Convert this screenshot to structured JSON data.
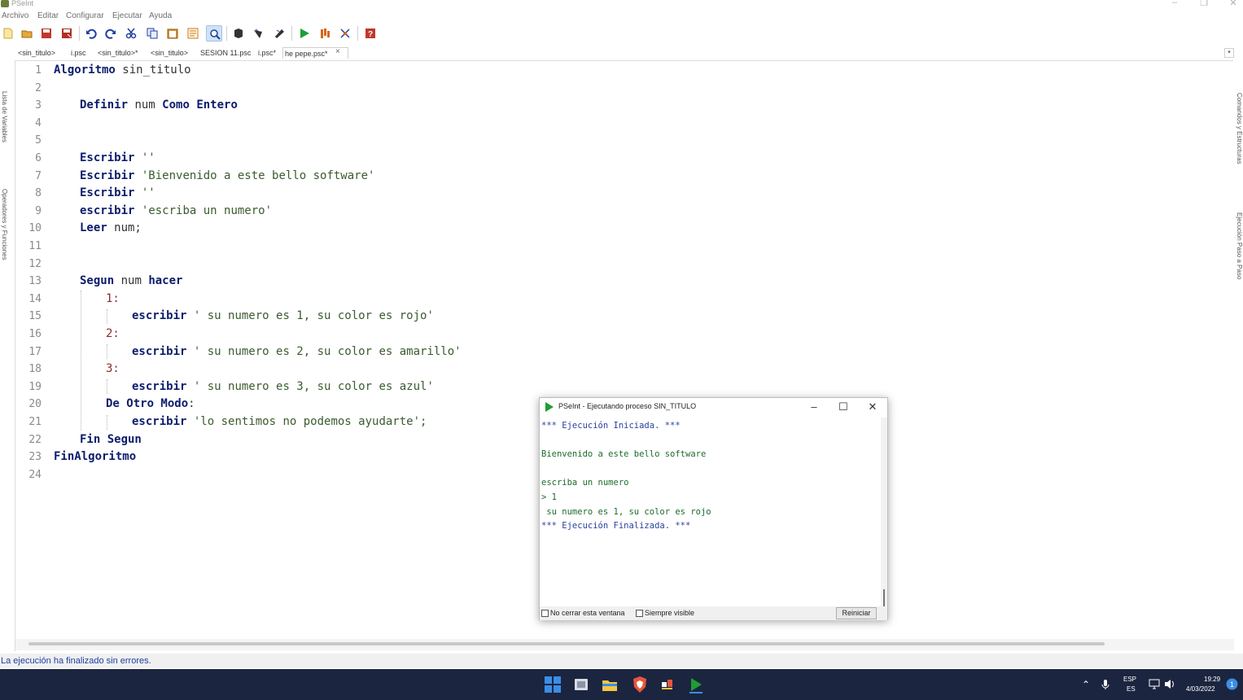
{
  "window": {
    "title": "PSeInt"
  },
  "menu": [
    "Archivo",
    "Editar",
    "Configurar",
    "Ejecutar",
    "Ayuda"
  ],
  "toolbar": [
    {
      "icon": "new-file-icon",
      "color": "#f2d35a"
    },
    {
      "icon": "open-folder-icon",
      "color": "#d9962b"
    },
    {
      "icon": "save-icon",
      "color": "#c0392b"
    },
    {
      "icon": "save-as-icon",
      "color": "#c0392b"
    },
    {
      "icon": "undo-icon",
      "color": "#1f3fa0"
    },
    {
      "icon": "redo-icon",
      "color": "#1f3fa0"
    },
    {
      "icon": "cut-icon",
      "color": "#1f3fa0"
    },
    {
      "icon": "copy-icon",
      "color": "#1f3fa0"
    },
    {
      "icon": "paste-icon",
      "color": "#c97a1a"
    },
    {
      "icon": "indent-icon",
      "color": "#c97a1a"
    },
    {
      "icon": "search-icon",
      "color": "#1f3fa0"
    },
    {
      "icon": "flowchart-icon",
      "color": "#222222"
    },
    {
      "icon": "debug-icon",
      "color": "#222222"
    },
    {
      "icon": "step-icon",
      "color": "#222222"
    },
    {
      "icon": "run-icon",
      "color": "#1e9e33"
    },
    {
      "icon": "step-by-step-icon",
      "color": "#d9661b"
    },
    {
      "icon": "draw-flow-icon",
      "color": "#1f3fa0"
    },
    {
      "icon": "help-icon",
      "color": "#c0392b"
    }
  ],
  "left_panel": {
    "vars": "Lista de Variables",
    "ops": "Operadores y Funciones"
  },
  "right_panel": {
    "commands": "Comandos y Estructuras",
    "exec": "Ejecución Paso a Paso"
  },
  "tabs": [
    {
      "label": "<sin_titulo>"
    },
    {
      "label": "i.psc"
    },
    {
      "label": "<sin_titulo>*"
    },
    {
      "label": "<sin_titulo>"
    },
    {
      "label": "SESION 11.psc"
    },
    {
      "label": "i.psc*"
    },
    {
      "label": "he pepe.psc*"
    }
  ],
  "tab_close": "×",
  "editor": {
    "lines": [
      {
        "n": "1"
      },
      {
        "n": "2"
      },
      {
        "n": "3"
      },
      {
        "n": "4"
      },
      {
        "n": "5"
      },
      {
        "n": "6"
      },
      {
        "n": "7"
      },
      {
        "n": "8"
      },
      {
        "n": "9"
      },
      {
        "n": "10"
      },
      {
        "n": "11"
      },
      {
        "n": "12"
      },
      {
        "n": "13"
      },
      {
        "n": "14"
      },
      {
        "n": "15"
      },
      {
        "n": "16"
      },
      {
        "n": "17"
      },
      {
        "n": "18"
      },
      {
        "n": "19"
      },
      {
        "n": "20"
      },
      {
        "n": "21"
      },
      {
        "n": "22"
      },
      {
        "n": "23"
      },
      {
        "n": "24"
      }
    ],
    "tokens": {
      "l1_kw": "Algoritmo",
      "l1_rest": " sin_titulo",
      "l3_kw1": "Definir",
      "l3_mid": " num ",
      "l3_kw2": "Como Entero",
      "l6_kw": "Escribir",
      "l6_str": " ''",
      "l7_kw": "Escribir",
      "l7_str": " 'Bienvenido a este bello software'",
      "l8_kw": "Escribir",
      "l8_str": " ''",
      "l9_kw": "escribir",
      "l9_str": " 'escriba un numero'",
      "l10_kw": "Leer",
      "l10_rest": " num;",
      "l13_kw1": "Segun",
      "l13_mid": " num ",
      "l13_kw2": "hacer",
      "l14_case": "1:",
      "l15_kw": "escribir",
      "l15_str": " ' su numero es 1, su color es rojo'",
      "l16_case": "2:",
      "l17_kw": "escribir",
      "l17_str": " ' su numero es 2, su color es amarillo'",
      "l18_case": "3:",
      "l19_kw": "escribir",
      "l19_str": " ' su numero es 3, su color es azul'",
      "l20_kw": "De Otro Modo",
      "l20_rest": ":",
      "l21_kw": "escribir",
      "l21_str": " 'lo sentimos no podemos ayudarte';",
      "l22_kw": "Fin Segun",
      "l23_kw": "FinAlgoritmo"
    }
  },
  "status": {
    "text": "La ejecución ha finalizado sin errores."
  },
  "exec_window": {
    "title": "PSeInt - Ejecutando proceso SIN_TITULO",
    "controls": {
      "min": "–",
      "max": "☐",
      "close": "✕"
    },
    "output": {
      "start": "*** Ejecución Iniciada. ***",
      "welcome": "Bienvenido a este bello software",
      "prompt": "escriba un numero",
      "input": "> 1",
      "result": " su numero es 1, su color es rojo",
      "end": "*** Ejecución Finalizada. ***"
    },
    "no_close_label": "No cerrar esta ventana",
    "always_visible_label": "Siempre visible",
    "restart_label": "Reiniciar"
  },
  "taskbar": {
    "apps": [
      "windows-start-icon",
      "task-view-icon",
      "file-explorer-icon",
      "brave-browser-icon",
      "paint-app-icon",
      "pseint-app-icon"
    ],
    "lang_top": "ESP",
    "lang_bottom": "ES",
    "time": "19:29",
    "date": "4/03/2022",
    "colors": {
      "taskbar_bg": "#1b2540",
      "accent": "#3a8ee6"
    }
  }
}
